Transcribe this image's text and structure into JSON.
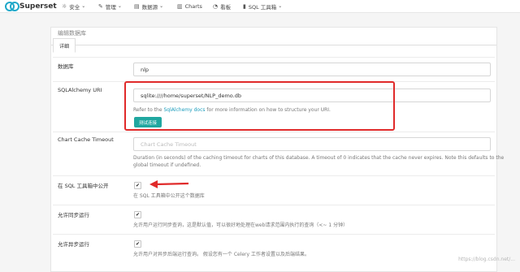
{
  "navbar": {
    "brand": "Superset",
    "items": [
      {
        "icon": "☼",
        "icon_name": "shield-icon",
        "label": "安全",
        "dropdown": true
      },
      {
        "icon": "✎",
        "icon_name": "wrench-icon",
        "label": "管理",
        "dropdown": true
      },
      {
        "icon": "▤",
        "icon_name": "database-icon",
        "label": "数据源",
        "dropdown": true
      },
      {
        "icon": "▥",
        "icon_name": "bar-chart-icon",
        "label": "Charts",
        "dropdown": false
      },
      {
        "icon": "◔",
        "icon_name": "dashboard-icon",
        "label": "看板",
        "dropdown": false
      },
      {
        "icon": "▮",
        "icon_name": "flask-icon",
        "label": "SQL 工具箱",
        "dropdown": true
      }
    ]
  },
  "panel": {
    "title": "编辑数据库",
    "tab": "详细"
  },
  "form": {
    "database_label": "数据库",
    "database_value": "nlp",
    "uri_label": "SQLAlchemy URI",
    "uri_value": "sqlite:////home/superset/NLP_demo.db",
    "uri_help_prefix": "Refer to the ",
    "uri_help_link": "SqlAlchemy docs",
    "uri_help_suffix": " for more information on how to structure your URI.",
    "test_button": "测试连接",
    "cache_label": "Chart Cache Timeout",
    "cache_placeholder": "Chart Cache Timeout",
    "cache_help_1": "Duration (in seconds) of the caching timeout for charts of this database. A timeout of 0 indicates that the cache never expires. Note this defaults to the",
    "cache_help_2": "global timeout if undefined.",
    "expose_label": "在 SQL 工具箱中公开",
    "expose_help": "在 SQL 工具箱中公开这个数据库",
    "sync_label": "允许同步运行",
    "sync_help": "允许用户运行同步查询，这是默认值，可以很好地处理在web请求范围内执行的查询（<~ 1 分钟）",
    "async_label": "允许异步运行",
    "async_help": "允许用户对异步后端运行查询。 假设您有一个 Celery 工作者设置以及后端结果。",
    "checkbox_mark": "✔"
  },
  "watermark": "https://blog.csdn.net/..."
}
